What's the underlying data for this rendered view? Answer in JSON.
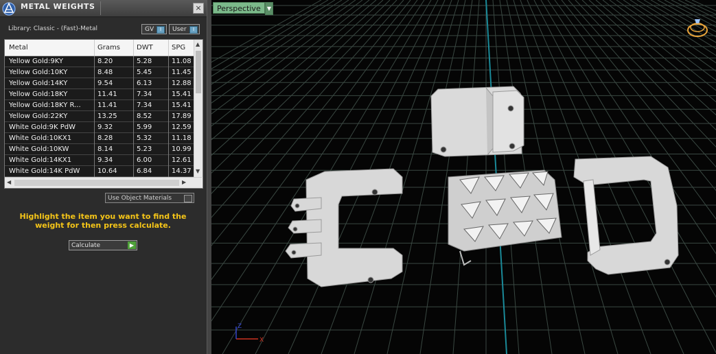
{
  "panel": {
    "title": "METAL WEIGHTS",
    "close_icon": "×",
    "library_label": "Library: Classic - (Fast)-Metal",
    "toggle_gv": "GV",
    "toggle_user": "User",
    "columns": [
      "Metal",
      "Grams",
      "DWT",
      "SPG"
    ],
    "rows": [
      [
        "Yellow Gold:9KY",
        "8.20",
        "5.28",
        "11.08"
      ],
      [
        "Yellow Gold:10KY",
        "8.48",
        "5.45",
        "11.45"
      ],
      [
        "Yellow Gold:14KY",
        "9.54",
        "6.13",
        "12.88"
      ],
      [
        "Yellow Gold:18KY",
        "11.41",
        "7.34",
        "15.41"
      ],
      [
        "Yellow Gold:18KY R...",
        "11.41",
        "7.34",
        "15.41"
      ],
      [
        "Yellow Gold:22KY",
        "13.25",
        "8.52",
        "17.89"
      ],
      [
        "White Gold:9K PdW",
        "9.32",
        "5.99",
        "12.59"
      ],
      [
        "White Gold:10KX1",
        "8.28",
        "5.32",
        "11.18"
      ],
      [
        "White Gold:10KW",
        "8.14",
        "5.23",
        "10.99"
      ],
      [
        "White Gold:14KX1",
        "9.34",
        "6.00",
        "12.61"
      ],
      [
        "White Gold:14K PdW",
        "10.64",
        "6.84",
        "14.37"
      ]
    ],
    "use_object_materials": "Use Object Materials",
    "instruction": "Highlight the item you want to find the weight for then press calculate.",
    "calculate": "Calculate"
  },
  "viewport": {
    "view_mode": "Perspective",
    "axis_x": "X",
    "axis_z": "Z"
  },
  "colors": {
    "accent_yellow": "#f5c518",
    "view_label_green": "#7bb98a",
    "grid": "#3c4a44",
    "model": "#d8d8d8"
  }
}
